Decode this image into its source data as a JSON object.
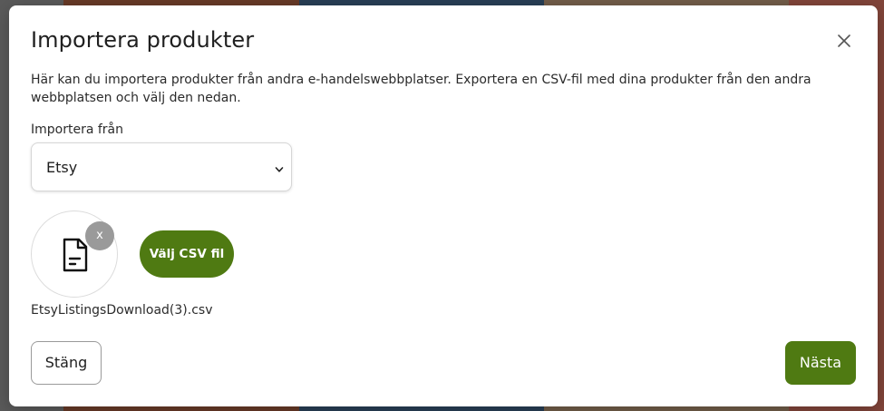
{
  "modal": {
    "title": "Importera produkter",
    "description": "Här kan du importera produkter från andra e-handelswebbplatser. Exportera en CSV-fil med dina produkter från den andra webbplatsen och välj den nedan.",
    "import_from_label": "Importera från",
    "import_from_value": "Etsy",
    "remove_file_label": "x",
    "choose_csv_label": "Välj CSV fil",
    "file_name": "EtsyListingsDownload(3).csv",
    "close_label": "Stäng",
    "next_label": "Nästa"
  },
  "icons": {
    "close": "close-icon",
    "file": "file-icon",
    "select_chevron": "chevron-down-icon"
  },
  "colors": {
    "primary_green": "#4f7a12",
    "badge_gray": "#9a9a9a",
    "overlay": "rgba(0,0,0,0.35)"
  }
}
